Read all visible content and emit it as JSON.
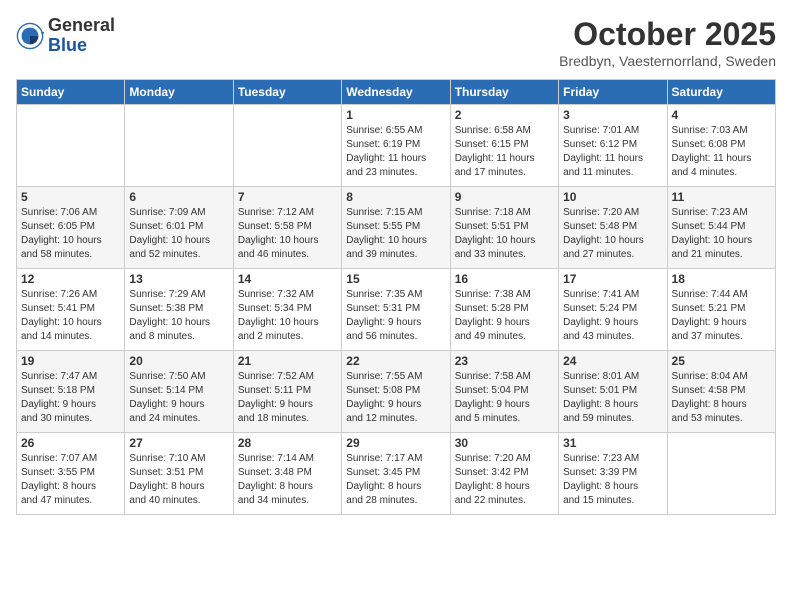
{
  "header": {
    "logo_general": "General",
    "logo_blue": "Blue",
    "month_title": "October 2025",
    "location": "Bredbyn, Vaesternorrland, Sweden"
  },
  "weekdays": [
    "Sunday",
    "Monday",
    "Tuesday",
    "Wednesday",
    "Thursday",
    "Friday",
    "Saturday"
  ],
  "weeks": [
    [
      {
        "day": "",
        "info": ""
      },
      {
        "day": "",
        "info": ""
      },
      {
        "day": "",
        "info": ""
      },
      {
        "day": "1",
        "info": "Sunrise: 6:55 AM\nSunset: 6:19 PM\nDaylight: 11 hours\nand 23 minutes."
      },
      {
        "day": "2",
        "info": "Sunrise: 6:58 AM\nSunset: 6:15 PM\nDaylight: 11 hours\nand 17 minutes."
      },
      {
        "day": "3",
        "info": "Sunrise: 7:01 AM\nSunset: 6:12 PM\nDaylight: 11 hours\nand 11 minutes."
      },
      {
        "day": "4",
        "info": "Sunrise: 7:03 AM\nSunset: 6:08 PM\nDaylight: 11 hours\nand 4 minutes."
      }
    ],
    [
      {
        "day": "5",
        "info": "Sunrise: 7:06 AM\nSunset: 6:05 PM\nDaylight: 10 hours\nand 58 minutes."
      },
      {
        "day": "6",
        "info": "Sunrise: 7:09 AM\nSunset: 6:01 PM\nDaylight: 10 hours\nand 52 minutes."
      },
      {
        "day": "7",
        "info": "Sunrise: 7:12 AM\nSunset: 5:58 PM\nDaylight: 10 hours\nand 46 minutes."
      },
      {
        "day": "8",
        "info": "Sunrise: 7:15 AM\nSunset: 5:55 PM\nDaylight: 10 hours\nand 39 minutes."
      },
      {
        "day": "9",
        "info": "Sunrise: 7:18 AM\nSunset: 5:51 PM\nDaylight: 10 hours\nand 33 minutes."
      },
      {
        "day": "10",
        "info": "Sunrise: 7:20 AM\nSunset: 5:48 PM\nDaylight: 10 hours\nand 27 minutes."
      },
      {
        "day": "11",
        "info": "Sunrise: 7:23 AM\nSunset: 5:44 PM\nDaylight: 10 hours\nand 21 minutes."
      }
    ],
    [
      {
        "day": "12",
        "info": "Sunrise: 7:26 AM\nSunset: 5:41 PM\nDaylight: 10 hours\nand 14 minutes."
      },
      {
        "day": "13",
        "info": "Sunrise: 7:29 AM\nSunset: 5:38 PM\nDaylight: 10 hours\nand 8 minutes."
      },
      {
        "day": "14",
        "info": "Sunrise: 7:32 AM\nSunset: 5:34 PM\nDaylight: 10 hours\nand 2 minutes."
      },
      {
        "day": "15",
        "info": "Sunrise: 7:35 AM\nSunset: 5:31 PM\nDaylight: 9 hours\nand 56 minutes."
      },
      {
        "day": "16",
        "info": "Sunrise: 7:38 AM\nSunset: 5:28 PM\nDaylight: 9 hours\nand 49 minutes."
      },
      {
        "day": "17",
        "info": "Sunrise: 7:41 AM\nSunset: 5:24 PM\nDaylight: 9 hours\nand 43 minutes."
      },
      {
        "day": "18",
        "info": "Sunrise: 7:44 AM\nSunset: 5:21 PM\nDaylight: 9 hours\nand 37 minutes."
      }
    ],
    [
      {
        "day": "19",
        "info": "Sunrise: 7:47 AM\nSunset: 5:18 PM\nDaylight: 9 hours\nand 30 minutes."
      },
      {
        "day": "20",
        "info": "Sunrise: 7:50 AM\nSunset: 5:14 PM\nDaylight: 9 hours\nand 24 minutes."
      },
      {
        "day": "21",
        "info": "Sunrise: 7:52 AM\nSunset: 5:11 PM\nDaylight: 9 hours\nand 18 minutes."
      },
      {
        "day": "22",
        "info": "Sunrise: 7:55 AM\nSunset: 5:08 PM\nDaylight: 9 hours\nand 12 minutes."
      },
      {
        "day": "23",
        "info": "Sunrise: 7:58 AM\nSunset: 5:04 PM\nDaylight: 9 hours\nand 5 minutes."
      },
      {
        "day": "24",
        "info": "Sunrise: 8:01 AM\nSunset: 5:01 PM\nDaylight: 8 hours\nand 59 minutes."
      },
      {
        "day": "25",
        "info": "Sunrise: 8:04 AM\nSunset: 4:58 PM\nDaylight: 8 hours\nand 53 minutes."
      }
    ],
    [
      {
        "day": "26",
        "info": "Sunrise: 7:07 AM\nSunset: 3:55 PM\nDaylight: 8 hours\nand 47 minutes."
      },
      {
        "day": "27",
        "info": "Sunrise: 7:10 AM\nSunset: 3:51 PM\nDaylight: 8 hours\nand 40 minutes."
      },
      {
        "day": "28",
        "info": "Sunrise: 7:14 AM\nSunset: 3:48 PM\nDaylight: 8 hours\nand 34 minutes."
      },
      {
        "day": "29",
        "info": "Sunrise: 7:17 AM\nSunset: 3:45 PM\nDaylight: 8 hours\nand 28 minutes."
      },
      {
        "day": "30",
        "info": "Sunrise: 7:20 AM\nSunset: 3:42 PM\nDaylight: 8 hours\nand 22 minutes."
      },
      {
        "day": "31",
        "info": "Sunrise: 7:23 AM\nSunset: 3:39 PM\nDaylight: 8 hours\nand 15 minutes."
      },
      {
        "day": "",
        "info": ""
      }
    ]
  ]
}
